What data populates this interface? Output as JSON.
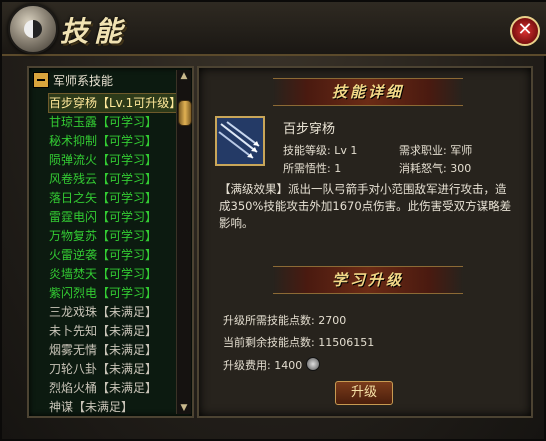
{
  "window": {
    "title": "技能",
    "close_label": "✕"
  },
  "category": {
    "label": "军师系技能"
  },
  "skills": [
    {
      "label": "百步穿杨【Lv.1可升级】",
      "state": "selected"
    },
    {
      "label": "甘琼玉露【可学习】",
      "state": "ok"
    },
    {
      "label": "秘术抑制【可学习】",
      "state": "ok"
    },
    {
      "label": "陨弹流火【可学习】",
      "state": "ok"
    },
    {
      "label": "风卷残云【可学习】",
      "state": "ok"
    },
    {
      "label": "落日之矢【可学习】",
      "state": "ok"
    },
    {
      "label": "雷霆电闪【可学习】",
      "state": "ok"
    },
    {
      "label": "万物复苏【可学习】",
      "state": "ok"
    },
    {
      "label": "火雷逆袭【可学习】",
      "state": "ok"
    },
    {
      "label": "炎墙焚天【可学习】",
      "state": "ok"
    },
    {
      "label": "紫闪烈电【可学习】",
      "state": "ok"
    },
    {
      "label": "三龙戏珠【未满足】",
      "state": "no"
    },
    {
      "label": "未卜先知【未满足】",
      "state": "no"
    },
    {
      "label": "烟雾无情【未满足】",
      "state": "no"
    },
    {
      "label": "刀轮八卦【未满足】",
      "state": "no"
    },
    {
      "label": "烈焰火桶【未满足】",
      "state": "no"
    },
    {
      "label": "神谋【未满足】",
      "state": "no"
    }
  ],
  "detail": {
    "header": "技能详细",
    "name": "百步穿杨",
    "level_label": "技能等级: Lv 1",
    "job_label": "需求职业: 军师",
    "wisdom_label": "所需悟性: 1",
    "anger_label": "消耗怒气: 300",
    "effect": "【满级效果】派出一队弓箭手对小范围敌军进行攻击，造成350%技能攻击外加1670点伤害。此伤害受双方谋略差影响。"
  },
  "upgrade": {
    "header": "学习升级",
    "points_needed": "升级所需技能点数: 2700",
    "points_left": "当前剩余技能点数: 11506151",
    "cost": "升级费用: 1400",
    "button_label": "升级"
  }
}
